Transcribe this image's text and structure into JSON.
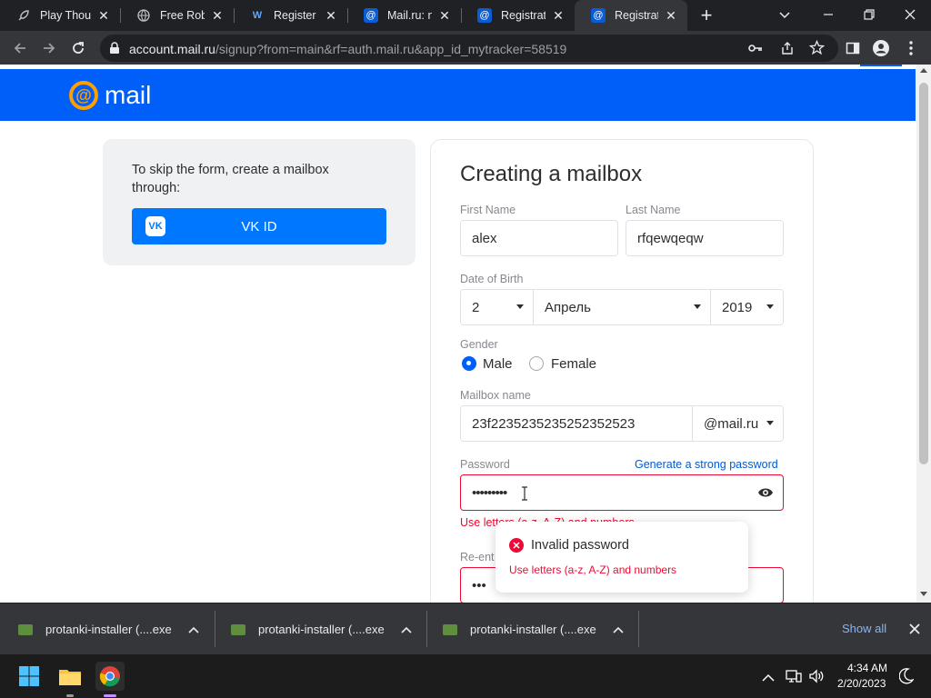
{
  "browser": {
    "tabs": [
      {
        "title": "Play Thousands",
        "favicon": "rocket-icon"
      },
      {
        "title": "Free Robux",
        "favicon": "globe-icon"
      },
      {
        "title": "Register | W",
        "favicon": "w-logo-icon"
      },
      {
        "title": "Mail.ru: novaya",
        "favicon": "mailru-at-icon"
      },
      {
        "title": "Registration",
        "favicon": "mailru-at-icon"
      },
      {
        "title": "Registration",
        "favicon": "mailru-at-icon"
      }
    ],
    "new_tab_glyph": "+",
    "url_host": "account.mail.ru",
    "url_path": "/signup?from=main&rf=auth.mail.ru&app_id_mytracker=58519"
  },
  "page": {
    "logo_text": "mail",
    "logo_symbol": "@",
    "vk_card": {
      "text": "To skip the form, create a mailbox through:",
      "button_label": "VK ID",
      "button_icon_text": "VK"
    },
    "form": {
      "title": "Creating a mailbox",
      "first_name_label": "First Name",
      "first_name_value": "alex",
      "last_name_label": "Last Name",
      "last_name_value": "rfqewqeqw",
      "dob_label": "Date of Birth",
      "dob_day": "2",
      "dob_month": "Апрель",
      "dob_year": "2019",
      "gender_label": "Gender",
      "gender_male": "Male",
      "gender_female": "Female",
      "gender_selected": "Male",
      "mailbox_label": "Mailbox name",
      "mailbox_value": "23f2235235235252352523",
      "domain_value": "@mail.ru",
      "password_label": "Password",
      "generate_link": "Generate a strong password",
      "password_value": "•••••••••",
      "password_hint": "Use letters (a-z, A-Z) and numbers",
      "reenter_label": "Re-ent",
      "reenter_value": "•••"
    },
    "tooltip": {
      "title": "Invalid password",
      "message": "Use letters (a-z, A-Z) and numbers"
    },
    "colors": {
      "brand_blue": "#005ff9",
      "vk_blue": "#0077ff",
      "error_red": "#ed0a34",
      "logo_orange": "#ff9e00"
    }
  },
  "downloads": {
    "items": [
      {
        "name": "protanki-installer (....exe"
      },
      {
        "name": "protanki-installer (....exe"
      },
      {
        "name": "protanki-installer (....exe"
      }
    ],
    "show_all": "Show all"
  },
  "taskbar": {
    "time": "4:34 AM",
    "date": "2/20/2023"
  }
}
